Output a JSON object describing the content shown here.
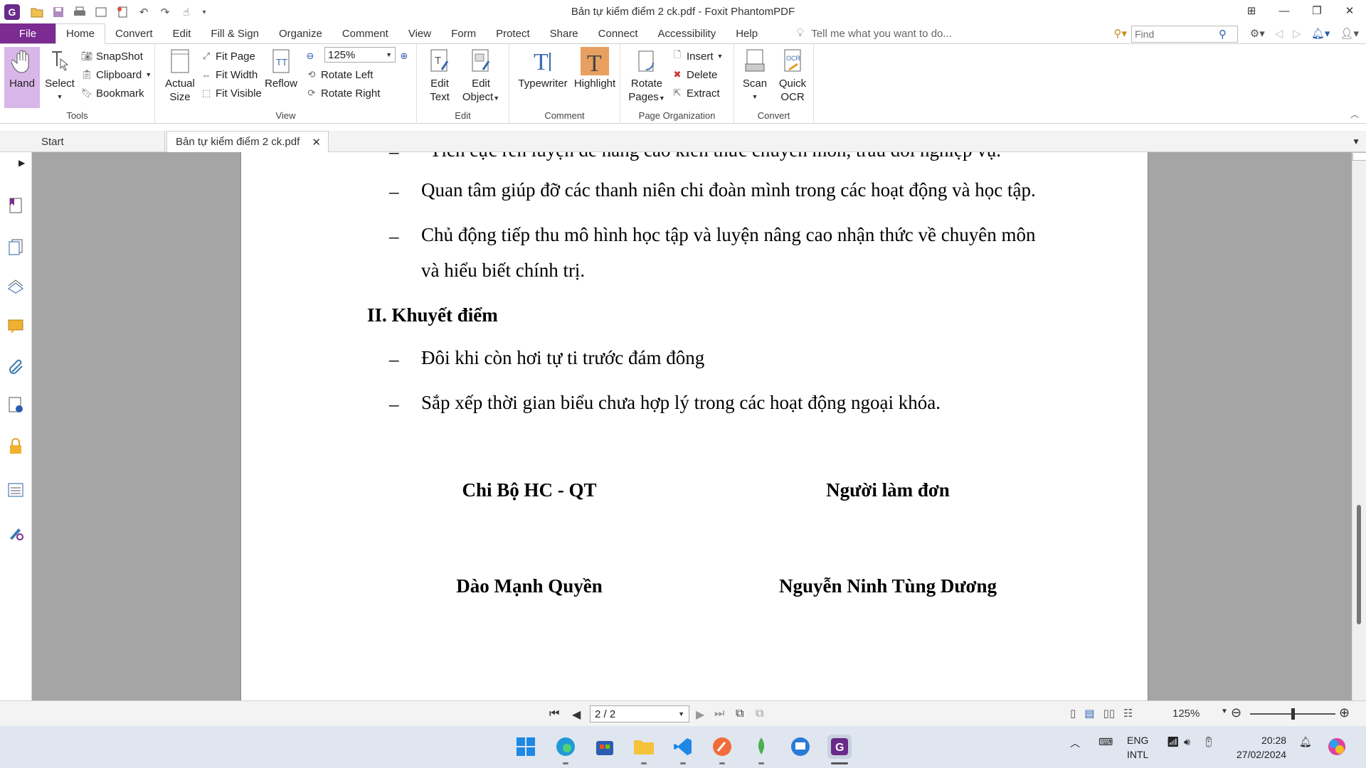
{
  "window": {
    "title": "Bản tự kiểm điểm 2 ck.pdf - Foxit PhantomPDF"
  },
  "menu": {
    "file": "File",
    "tabs": [
      "Home",
      "Convert",
      "Edit",
      "Fill & Sign",
      "Organize",
      "Comment",
      "View",
      "Form",
      "Protect",
      "Share",
      "Connect",
      "Accessibility",
      "Help"
    ],
    "tellme": "Tell me what you want to do...",
    "find_placeholder": "Find"
  },
  "ribbon": {
    "tools": {
      "label": "Tools",
      "hand": "Hand",
      "select": "Select",
      "snapshot": "SnapShot",
      "clipboard": "Clipboard",
      "bookmark": "Bookmark"
    },
    "view": {
      "label": "View",
      "actual_size_1": "Actual",
      "actual_size_2": "Size",
      "fit_page": "Fit Page",
      "fit_width": "Fit Width",
      "fit_visible": "Fit Visible",
      "reflow": "Reflow",
      "zoom": "125%",
      "rotate_left": "Rotate Left",
      "rotate_right": "Rotate Right"
    },
    "edit": {
      "label": "Edit",
      "edit_text_1": "Edit",
      "edit_text_2": "Text",
      "edit_object_1": "Edit",
      "edit_object_2": "Object"
    },
    "comment": {
      "label": "Comment",
      "typewriter": "Typewriter",
      "highlight": "Highlight"
    },
    "page_org": {
      "label": "Page Organization",
      "rotate_pages_1": "Rotate",
      "rotate_pages_2": "Pages",
      "insert": "Insert",
      "delete": "Delete",
      "extract": "Extract"
    },
    "convert": {
      "label": "Convert",
      "scan": "Scan",
      "quick_ocr_1": "Quick",
      "quick_ocr_2": "OCR"
    }
  },
  "doc_tabs": {
    "start": "Start",
    "document": "Bản tự kiểm điểm 2 ck.pdf"
  },
  "document": {
    "partial_line": "Tích cực rèn luyện để nâng cao kiến thức chuyên môn, trau dồi nghiệp vụ.",
    "bullet_marker": "–",
    "strengths": [
      "Quan tâm giúp đỡ các thanh niên chi đoàn mình trong các hoạt động và học tập.",
      "Chủ động tiếp thu mô hình học tập và luyện nâng cao nhận thức về chuyên môn",
      "và hiểu biết chính trị."
    ],
    "weakness_heading": "II. Khuyết điểm",
    "weaknesses": [
      "Đôi khi còn hơi tự ti trước đám đông",
      "Sắp xếp thời gian biểu chưa hợp lý trong các hoạt động ngoại khóa."
    ],
    "sign_left_title": "Chi Bộ HC - QT",
    "sign_right_title": "Người làm đơn",
    "sign_left_name": "Dào Mạnh Quyền",
    "sign_right_name": "Nguyễn Ninh Tùng Dương"
  },
  "status": {
    "page_indicator": "2 / 2",
    "zoom": "125%"
  },
  "taskbar": {
    "lang_1": "ENG",
    "lang_2": "INTL",
    "time": "20:28",
    "date": "27/02/2024"
  },
  "colors": {
    "accent": "#7b2b91",
    "hand_active": "#d9b6e8",
    "highlight": "#e8a060"
  }
}
